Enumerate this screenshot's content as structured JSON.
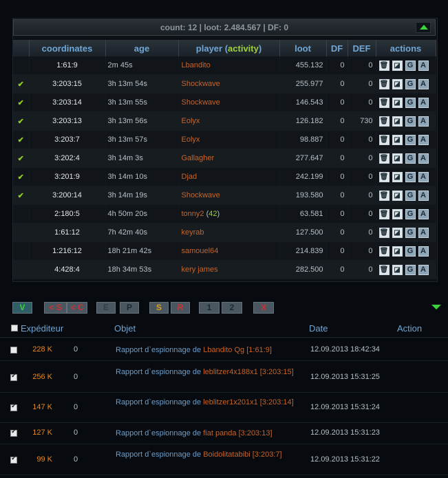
{
  "summary": {
    "text": "count: 12 | loot: 2.484.567 | DF: 0"
  },
  "fleet_table": {
    "headers": {
      "coordinates": "coordinates",
      "age": "age",
      "player": "player",
      "activity": "activity",
      "loot": "loot",
      "df": "DF",
      "def": "DEF",
      "actions": "actions"
    },
    "action_labels": {
      "trash": "🗑",
      "open": "◪",
      "g": "G",
      "a": "A"
    },
    "rows": [
      {
        "checked": false,
        "coords": "1:61:9",
        "age": "2m 45s",
        "player": "Lbandito",
        "activity": "",
        "loot": "455.132",
        "df": "0",
        "def": "0"
      },
      {
        "checked": true,
        "coords": "3:203:15",
        "age": "3h 13m 54s",
        "player": "Shockwave",
        "activity": "",
        "loot": "255.977",
        "df": "0",
        "def": "0"
      },
      {
        "checked": true,
        "coords": "3:203:14",
        "age": "3h 13m 55s",
        "player": "Shockwave",
        "activity": "",
        "loot": "146.543",
        "df": "0",
        "def": "0"
      },
      {
        "checked": true,
        "coords": "3:203:13",
        "age": "3h 13m 56s",
        "player": "Eolyx",
        "activity": "",
        "loot": "126.182",
        "df": "0",
        "def": "730"
      },
      {
        "checked": true,
        "coords": "3:203:7",
        "age": "3h 13m 57s",
        "player": "Eolyx",
        "activity": "",
        "loot": "98.887",
        "df": "0",
        "def": "0"
      },
      {
        "checked": true,
        "coords": "3:202:4",
        "age": "3h 14m 3s",
        "player": "Gallagher",
        "activity": "",
        "loot": "277.647",
        "df": "0",
        "def": "0"
      },
      {
        "checked": true,
        "coords": "3:201:9",
        "age": "3h 14m 10s",
        "player": "Djad",
        "activity": "",
        "loot": "242.199",
        "df": "0",
        "def": "0"
      },
      {
        "checked": true,
        "coords": "3:200:14",
        "age": "3h 14m 19s",
        "player": "Shockwave",
        "activity": "",
        "loot": "193.580",
        "df": "0",
        "def": "0"
      },
      {
        "checked": false,
        "coords": "2:180:5",
        "age": "4h 50m 20s",
        "player": "tonny2",
        "activity": "42",
        "loot": "63.581",
        "df": "0",
        "def": "0"
      },
      {
        "checked": false,
        "coords": "1:61:12",
        "age": "7h 42m 40s",
        "player": "keyrab",
        "activity": "",
        "loot": "127.500",
        "df": "0",
        "def": "0"
      },
      {
        "checked": false,
        "coords": "1:216:12",
        "age": "18h 21m 42s",
        "player": "samouel64",
        "activity": "",
        "loot": "214.839",
        "df": "0",
        "def": "0"
      },
      {
        "checked": false,
        "coords": "4:428:4",
        "age": "18h 34m 53s",
        "player": "kery james",
        "activity": "",
        "loot": "282.500",
        "df": "0",
        "def": "0"
      }
    ]
  },
  "filters": [
    {
      "label": "V",
      "color": "#3cd23c",
      "bg": "#2e5f66"
    },
    {
      "label": "< S",
      "color": "#d03030",
      "bg": "#4a5660"
    },
    {
      "label": "< C",
      "color": "#d03030",
      "bg": "#4a5660"
    },
    {
      "label": "E",
      "color": "#33404a",
      "bg": "#4a5660"
    },
    {
      "label": "P",
      "color": "#20282e",
      "bg": "#4a5660"
    },
    {
      "label": "S",
      "color": "#e0a020",
      "bg": "#4a5660"
    },
    {
      "label": "R",
      "color": "#d03030",
      "bg": "#4a5660"
    },
    {
      "label": "1",
      "color": "#20282e",
      "bg": "#4a5660"
    },
    {
      "label": "2",
      "color": "#20282e",
      "bg": "#4a5660"
    },
    {
      "label": "X",
      "color": "#d03030",
      "bg": "#4a5660"
    }
  ],
  "messages": {
    "headers": {
      "sender": "Expéditeur",
      "subject": "Objet",
      "date": "Date",
      "action": "Action"
    },
    "rows": [
      {
        "checked": false,
        "size": "228 K",
        "zero": "0",
        "subject_prefix": "Rapport d`espionnage de",
        "subject_target": "Lbandito Qg [1:61:9]",
        "date": "12.09.2013 18:42:34"
      },
      {
        "checked": true,
        "size": "256 K",
        "zero": "0",
        "subject_prefix": "Rapport d`espionnage de",
        "subject_target": "leblitzer4x188x1 [3:203:15]",
        "date": "12.09.2013 15:31:25"
      },
      {
        "checked": true,
        "size": "147 K",
        "zero": "0",
        "subject_prefix": "Rapport d`espionnage de",
        "subject_target": "leblitzer1x201x1 [3:203:14]",
        "date": "12.09.2013 15:31:24"
      },
      {
        "checked": true,
        "size": "127 K",
        "zero": "0",
        "subject_prefix": "Rapport d`espionnage de",
        "subject_target": "fiat panda [3:203:13]",
        "date": "12.09.2013 15:31:23"
      },
      {
        "checked": true,
        "size": "99 K",
        "zero": "0",
        "subject_prefix": "Rapport d`espionnage de",
        "subject_target": "Boidolitatabibi [3:203:7]",
        "date": "12.09.2013 15:31:22"
      }
    ]
  }
}
